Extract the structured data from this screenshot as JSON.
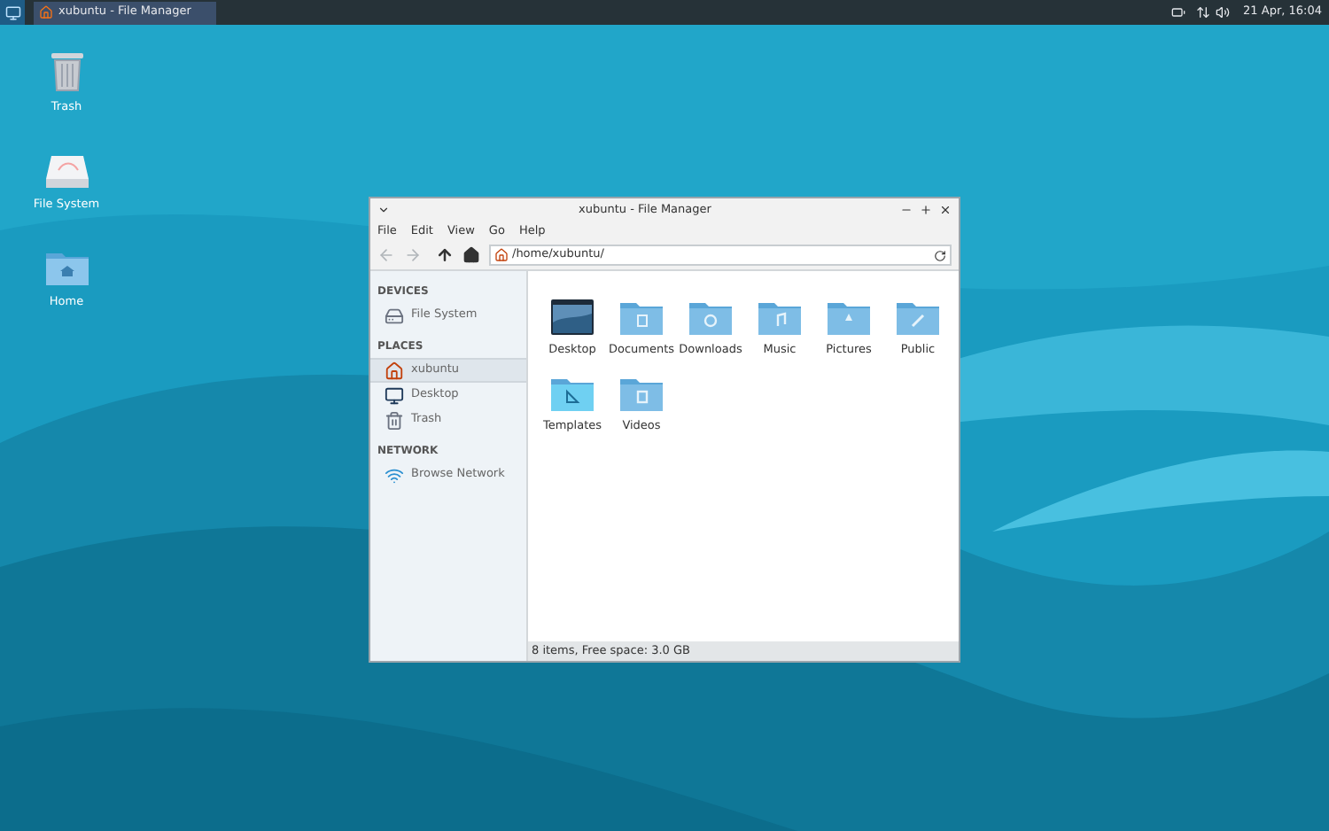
{
  "panel": {
    "task": {
      "title": "xubuntu - File Manager",
      "selected": true
    },
    "clock": "21 Apr, 16:04"
  },
  "desktop_icons": [
    {
      "label": "Trash",
      "kind": "trash"
    },
    {
      "label": "File System",
      "kind": "drive"
    },
    {
      "label": "Home",
      "kind": "home"
    }
  ],
  "window": {
    "title": "xubuntu - File Manager",
    "menu": [
      "File",
      "Edit",
      "View",
      "Go",
      "Help"
    ],
    "location": "/home/xubuntu/",
    "sidebar": [
      {
        "heading": "DEVICES",
        "items": [
          {
            "label": "File System",
            "kind": "drive",
            "selected": false
          }
        ]
      },
      {
        "heading": "PLACES",
        "items": [
          {
            "label": "xubuntu",
            "kind": "home",
            "selected": true
          },
          {
            "label": "Desktop",
            "kind": "desktop",
            "selected": false
          },
          {
            "label": "Trash",
            "kind": "trash",
            "selected": false
          }
        ]
      },
      {
        "heading": "NETWORK",
        "items": [
          {
            "label": "Browse Network",
            "kind": "network",
            "selected": false
          }
        ]
      }
    ],
    "files": [
      {
        "name": "Desktop",
        "kind": "desktop"
      },
      {
        "name": "Documents",
        "kind": "documents"
      },
      {
        "name": "Downloads",
        "kind": "downloads"
      },
      {
        "name": "Music",
        "kind": "music"
      },
      {
        "name": "Pictures",
        "kind": "pictures"
      },
      {
        "name": "Public",
        "kind": "public"
      },
      {
        "name": "Templates",
        "kind": "templates"
      },
      {
        "name": "Videos",
        "kind": "videos"
      }
    ],
    "status": "8 items, Free space: 3.0 GB"
  }
}
